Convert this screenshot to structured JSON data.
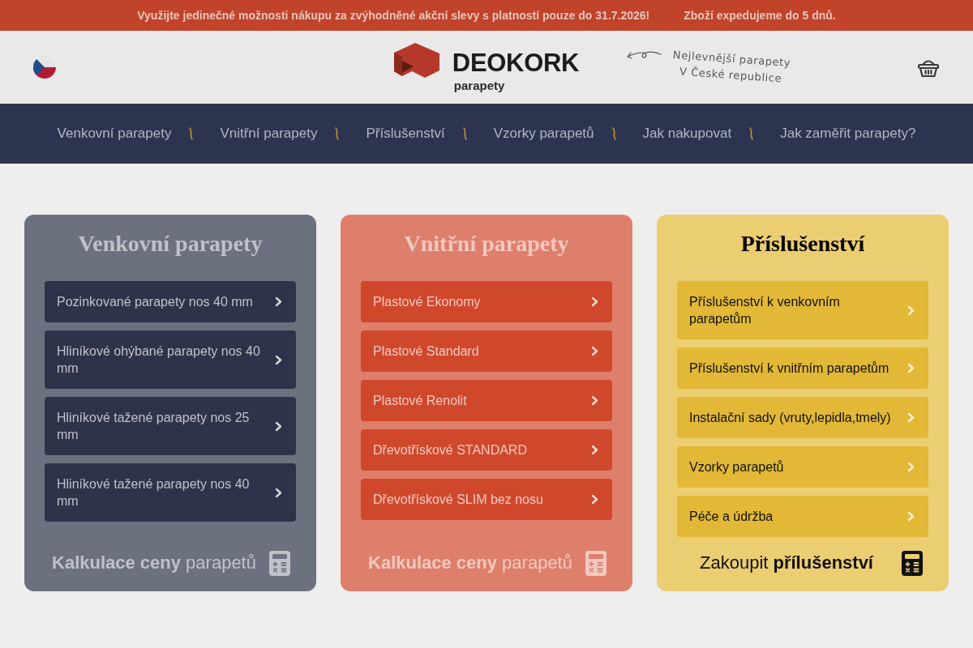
{
  "promo_bar": {
    "messages": [
      "Využijte jedinečné možnosti nákupu za zvýhodněné akční slevy s platností pouze do 31.7.2026!",
      "Zboží expedujeme do 5 dnů."
    ]
  },
  "header": {
    "logo": {
      "name": "DEOKORK",
      "subtitle": "parapety"
    },
    "tagline": [
      "Nejlevnější parapety",
      "V České republice"
    ]
  },
  "nav": {
    "items": [
      "Venkovní parapety",
      "Vnitřní parapety",
      "Příslušenství",
      "Vzorky parapetů",
      "Jak nakupovat",
      "Jak zaměřit parapety?"
    ]
  },
  "cards": [
    {
      "title": "Venkovní parapety",
      "color": "#6c7180",
      "items": [
        "Pozinkované parapety nos 40 mm",
        "Hliníkové ohýbané parapety nos 40 mm",
        "Hliníkové tažené parapety nos 25 mm",
        "Hliníkové tažené parapety nos 40 mm"
      ],
      "footer": "**Kalkulace ceny** parapetů"
    },
    {
      "title": "Vnitřní parapety",
      "color": "#de7f6b",
      "items": [
        "Plastové Ekonomy",
        "Plastové Standard",
        "Plastové Renolit",
        "Dřevotřískové STANDARD",
        "Dřevotřískové SLIM bez nosu"
      ],
      "footer": "**Kalkulace ceny** parapetů"
    },
    {
      "title": "Příslušenství",
      "color": "#ebcd72",
      "items": [
        "Příslušenství k venkovním parapetům",
        "Příslušenství k vnitřním parapetům",
        "Instalační sady (vruty,lepidla,tmely)",
        "Vzorky parapetů",
        "Péče a údržba"
      ],
      "footer": "Zakoupit **přílušenství**"
    }
  ]
}
